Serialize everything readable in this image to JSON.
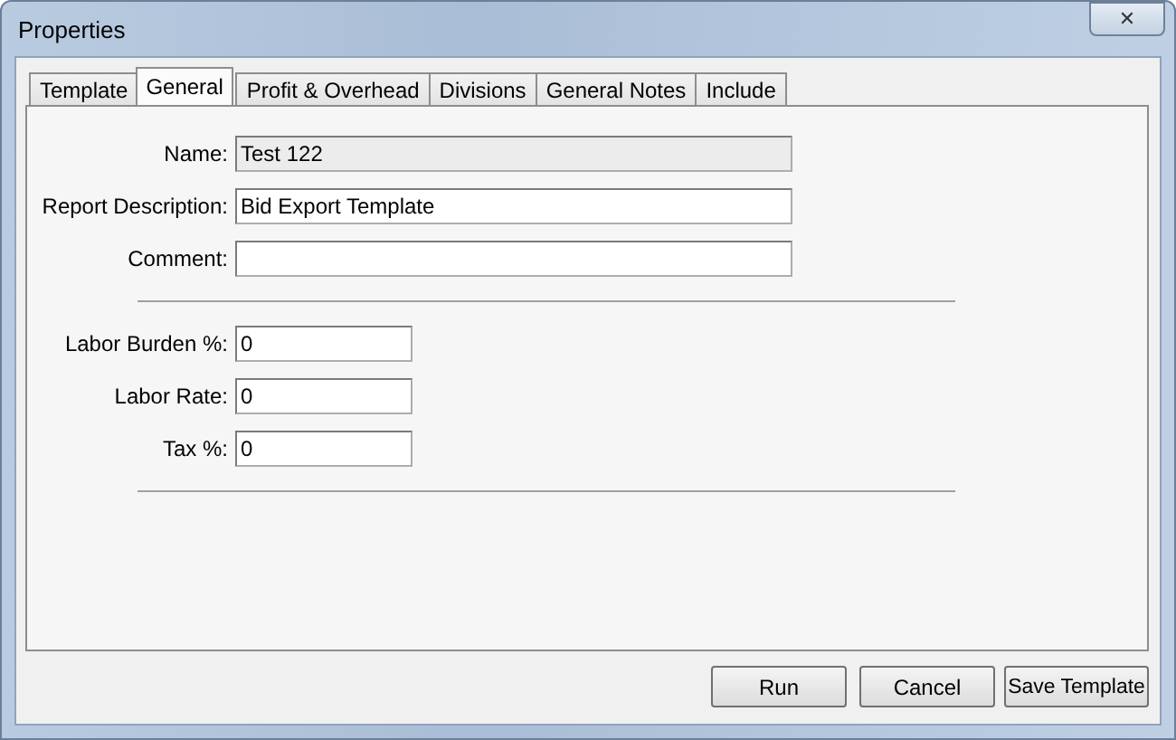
{
  "window": {
    "title": "Properties",
    "close": "✕"
  },
  "tabs": [
    {
      "label": "Template",
      "selected": false
    },
    {
      "label": "General",
      "selected": true
    },
    {
      "label": "Profit & Overhead",
      "selected": false
    },
    {
      "label": "Divisions",
      "selected": false
    },
    {
      "label": "General Notes",
      "selected": false
    },
    {
      "label": "Include",
      "selected": false
    }
  ],
  "groups": [
    {
      "wide": true,
      "fields": [
        {
          "label": "Name:",
          "value": "Test 122",
          "disabled": true
        },
        {
          "label": "Report Description:",
          "value": "Bid Export Template",
          "disabled": false
        },
        {
          "label": "Comment:",
          "disabled": false
        }
      ]
    },
    {
      "wide": false,
      "fields": [
        {
          "label": "Labor Burden %:",
          "value": "0",
          "disabled": false
        },
        {
          "label": "Labor Rate:",
          "value": "0",
          "disabled": false
        },
        {
          "label": "Tax %:",
          "value": "0",
          "disabled": false
        }
      ]
    }
  ],
  "buttons": [
    "Run",
    "Cancel",
    "Save Template"
  ]
}
